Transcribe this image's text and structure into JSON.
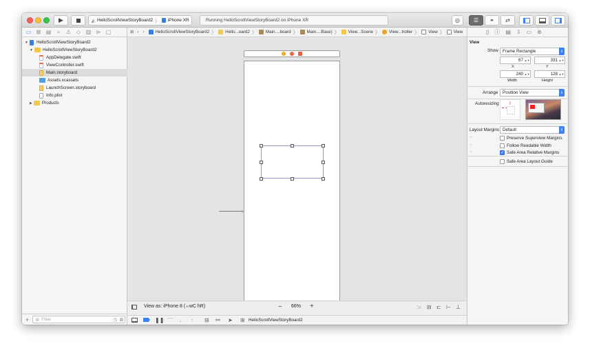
{
  "toolbar": {
    "scheme_name": "HelloScrollViewStoryBoard2",
    "device_name": "iPhone XR",
    "activity_status": "Running HelloScrollViewStoryBoard2 on iPhone XR"
  },
  "navigator": {
    "tree": [
      {
        "label": "HelloScrollViewStoryBoard2",
        "kind": "project"
      },
      {
        "label": "HelloScrollViewStoryBoard2",
        "kind": "folder"
      },
      {
        "label": "AppDelegate.swift",
        "kind": "swift"
      },
      {
        "label": "ViewController.swift",
        "kind": "swift"
      },
      {
        "label": "Main.storyboard",
        "kind": "storyboard"
      },
      {
        "label": "Assets.xcassets",
        "kind": "assets"
      },
      {
        "label": "LaunchScreen.storyboard",
        "kind": "storyboard"
      },
      {
        "label": "Info.plist",
        "kind": "plist"
      },
      {
        "label": "Products",
        "kind": "folder"
      }
    ],
    "filter_placeholder": "Filter"
  },
  "jump_bar": {
    "crumbs": [
      "HelloScrollViewStoryBoard2",
      "Hello...oard2",
      "Main....board",
      "Main....Base)",
      "View...Scene",
      "View...troller",
      "View",
      "View"
    ]
  },
  "canvas": {
    "view_as": "View as: iPhone 8 (",
    "view_as_traits": "wC hR)",
    "zoom": "66%",
    "zoom_out": "−",
    "zoom_in": "+",
    "debug_target": "HelloScrollViewStoryBoard2"
  },
  "inspector": {
    "section_title": "View",
    "show_label": "Show",
    "show_value": "Frame Rectangle",
    "x_value": "67",
    "y_value": "331",
    "x_label": "X",
    "y_label": "Y",
    "width_value": "240",
    "height_value": "128",
    "width_label": "Width",
    "height_label": "Height",
    "arrange_label": "Arrange",
    "arrange_value": "Position View",
    "autoresizing_label": "Autoresizing",
    "layout_margins_label": "Layout Margins",
    "layout_margins_value": "Default",
    "checks": [
      {
        "label": "Preserve Superview Margins",
        "checked": false
      },
      {
        "label": "Follow Readable Width",
        "checked": false
      },
      {
        "label": "Safe Area Relative Margins",
        "checked": true
      },
      {
        "label": "Safe Area Layout Guide",
        "checked": false
      }
    ]
  }
}
